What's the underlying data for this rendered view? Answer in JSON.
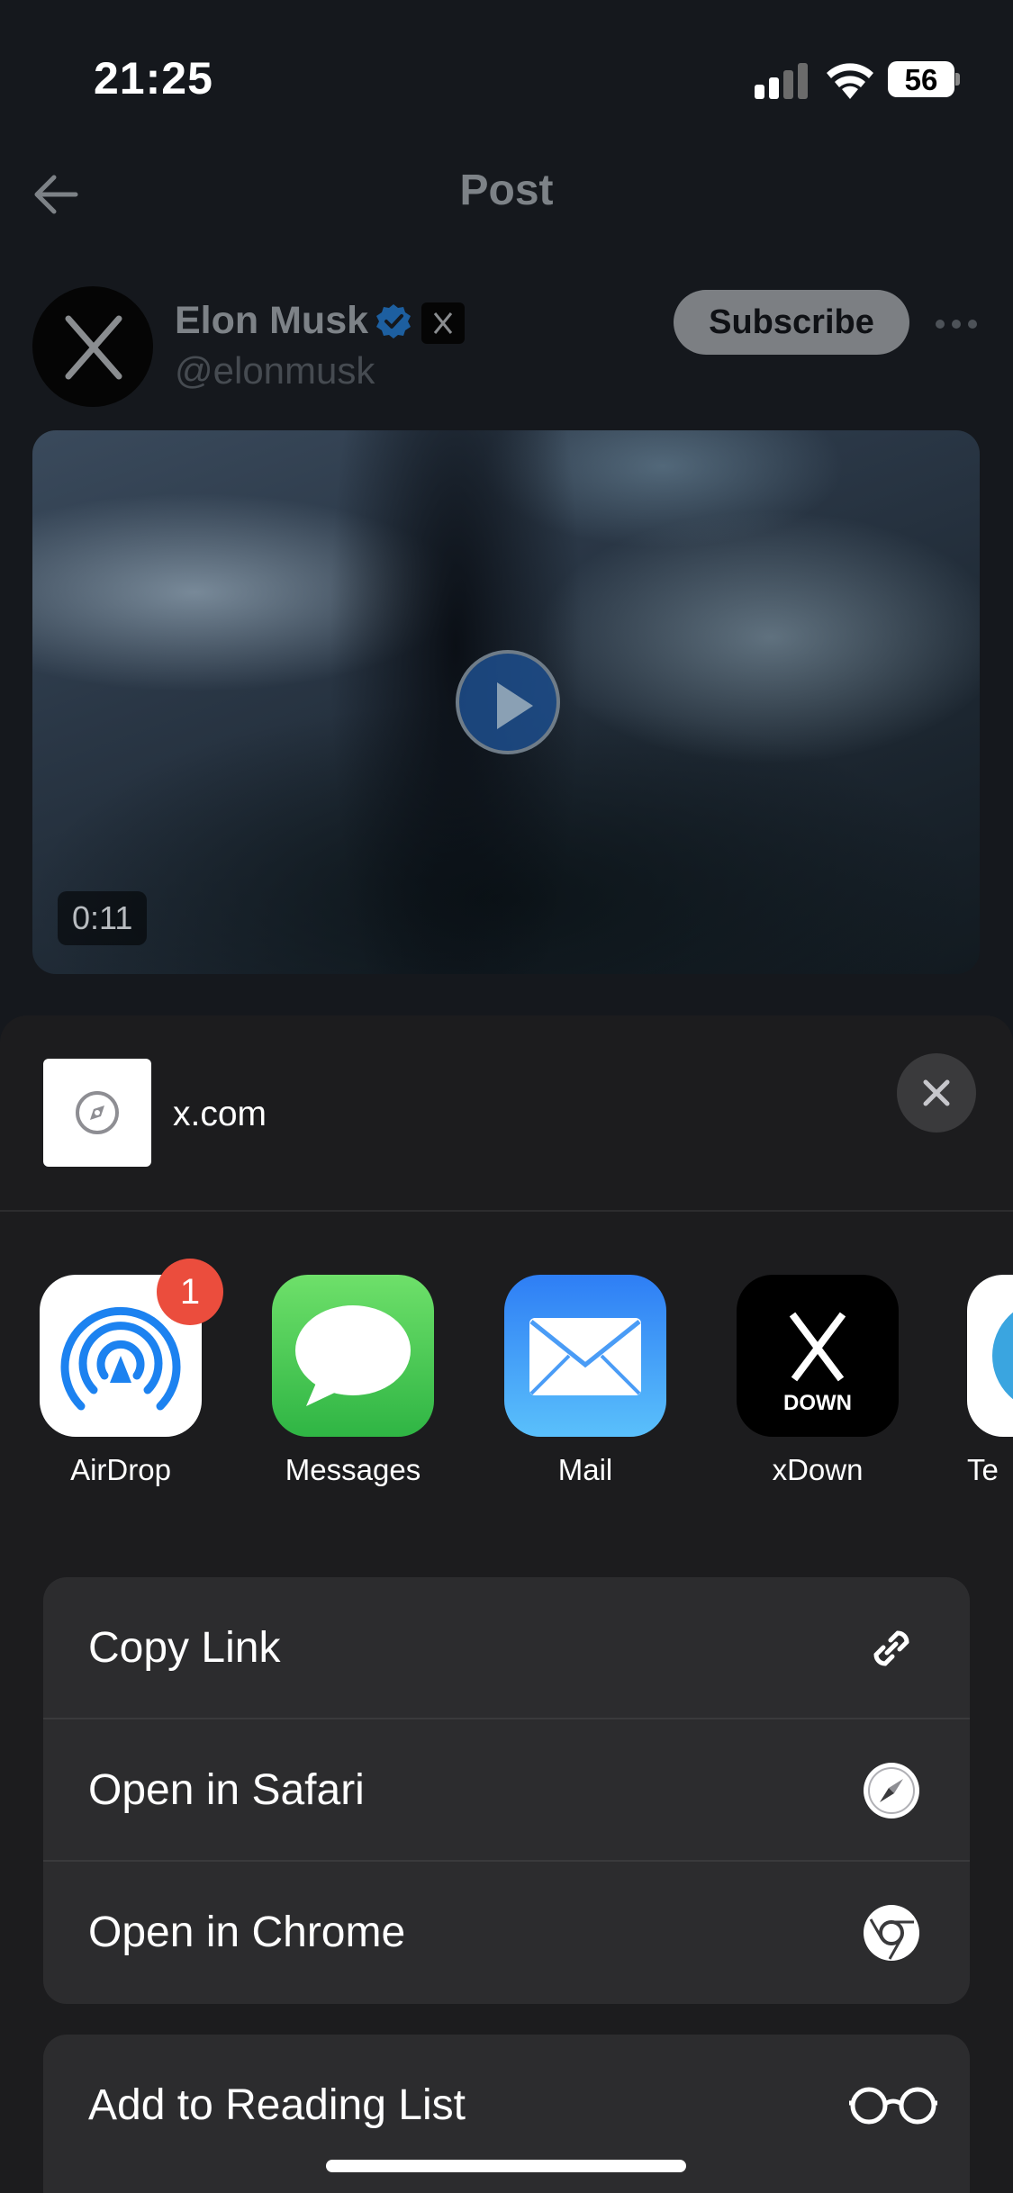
{
  "status_bar": {
    "time": "21:25",
    "battery": "56"
  },
  "nav": {
    "title": "Post"
  },
  "post": {
    "author_name": "Elon Musk",
    "author_handle": "@elonmusk",
    "subscribe_label": "Subscribe",
    "video_duration": "0:11"
  },
  "share_sheet": {
    "site_url": "x.com",
    "apps": [
      {
        "label": "AirDrop",
        "icon": "airdrop-icon",
        "badge": "1"
      },
      {
        "label": "Messages",
        "icon": "messages-icon"
      },
      {
        "label": "Mail",
        "icon": "mail-icon"
      },
      {
        "label": "xDown",
        "icon": "xdown-icon",
        "icon_text": "DOWN"
      },
      {
        "label": "Te",
        "icon": "telegram-icon"
      }
    ],
    "actions": [
      {
        "label": "Copy Link",
        "icon": "link-icon"
      },
      {
        "label": "Open in Safari",
        "icon": "safari-icon"
      },
      {
        "label": "Open in Chrome",
        "icon": "chrome-icon"
      }
    ],
    "actions2": [
      {
        "label": "Add to Reading List",
        "icon": "glasses-icon"
      }
    ]
  },
  "colors": {
    "sheet_bg": "#1c1c1e",
    "row_bg": "#2c2c2e",
    "badge_red": "#eb4d3d",
    "verified_blue": "#1d9bf0"
  }
}
